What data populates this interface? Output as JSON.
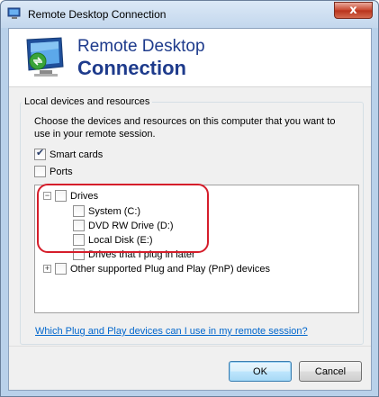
{
  "window": {
    "title": "Remote Desktop Connection",
    "close_glyph": "x"
  },
  "banner": {
    "line1": "Remote Desktop",
    "line2": "Connection"
  },
  "group": {
    "label": "Local devices and resources",
    "description": "Choose the devices and resources on this computer that you want to use in your remote session."
  },
  "options": [
    {
      "label": "Smart cards",
      "checked": true
    },
    {
      "label": "Ports",
      "checked": false
    }
  ],
  "tree": {
    "drives": {
      "label": "Drives",
      "expander": "−",
      "checked": false,
      "children": [
        {
          "label": "System (C:)",
          "checked": false
        },
        {
          "label": "DVD RW Drive (D:)",
          "checked": false
        },
        {
          "label": "Local Disk (E:)",
          "checked": false
        },
        {
          "label": "Drives that I plug in later",
          "checked": false
        }
      ]
    },
    "pnp": {
      "label": "Other supported Plug and Play (PnP) devices",
      "expander": "+",
      "checked": false
    }
  },
  "help_link": "Which Plug and Play devices can I use in my remote session?",
  "buttons": {
    "ok": "OK",
    "cancel": "Cancel"
  },
  "colors": {
    "title_blue": "#1e3b8c",
    "highlight_red": "#d51d2a",
    "link_blue": "#0066cc"
  }
}
